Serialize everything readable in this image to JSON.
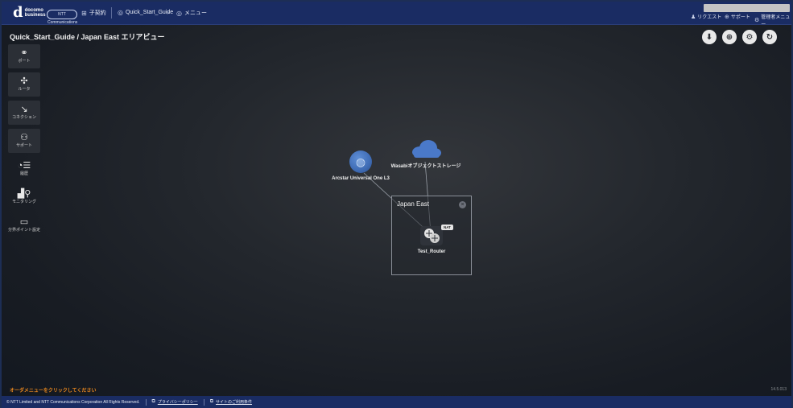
{
  "header": {
    "logo_mark": "d",
    "logo_line1": "docomo",
    "logo_line2": "business",
    "partner_badge": "NTT Communications",
    "contract_label": "子契約",
    "breadcrumb_project": "Quick_Start_Guide",
    "breadcrumb_menu": "メニュー",
    "links": {
      "request": "リクエスト",
      "support": "サポート",
      "admin_menu": "管理者メニュー"
    }
  },
  "page": {
    "title": "Quick_Start_Guide / Japan East エリアビュー"
  },
  "sidebar": {
    "items": [
      {
        "label": "ポート",
        "icon": "port-icon"
      },
      {
        "label": "ルータ",
        "icon": "router-icon"
      },
      {
        "label": "コネクション",
        "icon": "connection-icon"
      },
      {
        "label": "サポート",
        "icon": "support-icon"
      },
      {
        "label": "履歴",
        "icon": "history-icon"
      },
      {
        "label": "モニタリング",
        "icon": "monitoring-icon"
      },
      {
        "label": "分界ポイント設定",
        "icon": "demarcation-icon"
      }
    ]
  },
  "toolbar": {
    "download_icon": "download-icon",
    "globe_icon": "globe-icon",
    "settings_icon": "gear-icon",
    "refresh_icon": "refresh-icon"
  },
  "canvas": {
    "nodes": {
      "arcstar": "Arcstar Universal One L3",
      "wasabi": "Wasabiオブジェクトストレージ",
      "router": "Test_Router",
      "nat_badge": "NAT"
    },
    "area": {
      "title": "Japan East"
    }
  },
  "hint": "オーダメニューをクリックしてください",
  "version": "14.5.013",
  "footer": {
    "copyright": "© NTT Limited and NTT Communications Corporation All Rights Reserved.",
    "privacy": "プライバシーポリシー",
    "terms": "サイトのご利用条件"
  },
  "colors": {
    "header_bg": "#1a2c63",
    "hint": "#e8871e",
    "cloud": "#4a79c9"
  }
}
